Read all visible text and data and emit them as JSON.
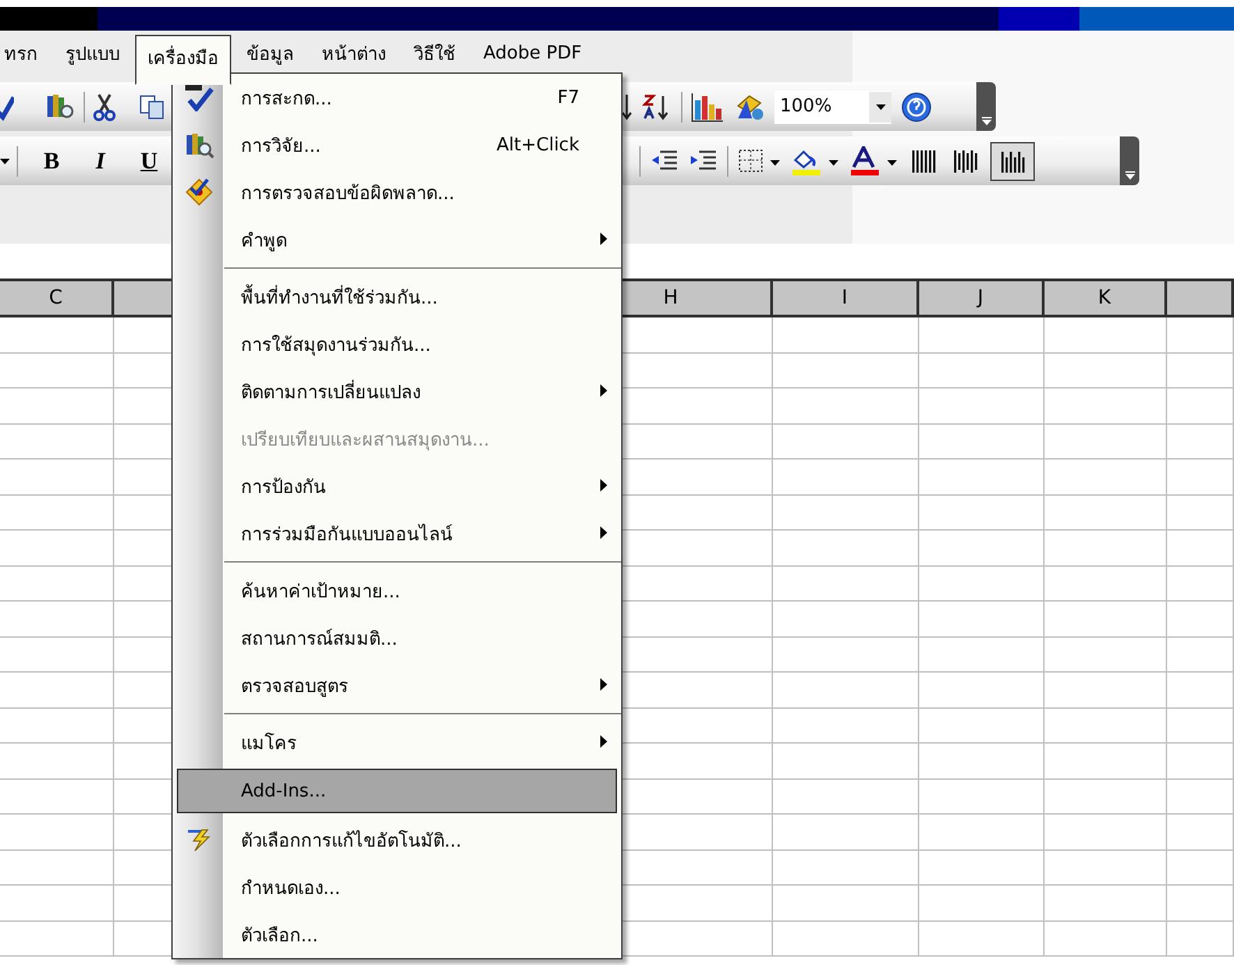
{
  "menu_bar": [
    {
      "label": "ทรก",
      "selected": false
    },
    {
      "label": "รูปแบบ",
      "selected": false
    },
    {
      "label": "เครื่องมือ",
      "selected": true
    },
    {
      "label": "ข้อมูล",
      "selected": false
    },
    {
      "label": "หน้าต่าง",
      "selected": false
    },
    {
      "label": "วิธีใช้",
      "selected": false
    },
    {
      "label": "Adobe PDF",
      "selected": false
    }
  ],
  "standard_toolbar": {
    "zoom": "100%"
  },
  "formatting_toolbar": {
    "text_buttons": [
      {
        "label": "B",
        "kind": "bold"
      },
      {
        "label": "I",
        "kind": "italic"
      },
      {
        "label": "U",
        "kind": "underline"
      }
    ],
    "layout_buttons": [
      {
        "pressed": false
      },
      {
        "pressed": false
      },
      {
        "pressed": true
      }
    ]
  },
  "menu": {
    "items": [
      {
        "kind": "item",
        "label": "การสะกด...",
        "shortcut": "F7",
        "submenu": false,
        "disabled": false,
        "selected": false
      },
      {
        "kind": "item",
        "label": "การวิจัย...",
        "shortcut": "Alt+Click",
        "submenu": false,
        "disabled": false,
        "selected": false
      },
      {
        "kind": "item",
        "label": "การตรวจสอบข้อผิดพลาด...",
        "submenu": false,
        "disabled": false,
        "selected": false
      },
      {
        "kind": "item",
        "label": "คำพูด",
        "submenu": true,
        "disabled": false,
        "selected": false
      },
      {
        "kind": "separator"
      },
      {
        "kind": "item",
        "label": "พื้นที่ทำงานที่ใช้ร่วมกัน...",
        "submenu": false,
        "disabled": false,
        "selected": false
      },
      {
        "kind": "item",
        "label": "การใช้สมุดงานร่วมกัน...",
        "submenu": false,
        "disabled": false,
        "selected": false
      },
      {
        "kind": "item",
        "label": "ติดตามการเปลี่ยนแปลง",
        "submenu": true,
        "disabled": false,
        "selected": false
      },
      {
        "kind": "item",
        "label": "เปรียบเทียบและผสานสมุดงาน...",
        "submenu": false,
        "disabled": true,
        "selected": false
      },
      {
        "kind": "item",
        "label": "การป้องกัน",
        "submenu": true,
        "disabled": false,
        "selected": false
      },
      {
        "kind": "item",
        "label": "การร่วมมือกันแบบออนไลน์",
        "submenu": true,
        "disabled": false,
        "selected": false
      },
      {
        "kind": "separator"
      },
      {
        "kind": "item",
        "label": "ค้นหาค่าเป้าหมาย...",
        "submenu": false,
        "disabled": false,
        "selected": false
      },
      {
        "kind": "item",
        "label": "สถานการณ์สมมติ...",
        "submenu": false,
        "disabled": false,
        "selected": false
      },
      {
        "kind": "item",
        "label": "ตรวจสอบสูตร",
        "submenu": true,
        "disabled": false,
        "selected": false
      },
      {
        "kind": "separator"
      },
      {
        "kind": "item",
        "label": "แมโคร",
        "submenu": true,
        "disabled": false,
        "selected": false
      },
      {
        "kind": "item",
        "label": "Add-Ins...",
        "submenu": false,
        "disabled": false,
        "selected": true
      },
      {
        "kind": "item",
        "label": "ตัวเลือกการแก้ไขอัตโนมัติ...",
        "submenu": false,
        "disabled": false,
        "selected": false
      },
      {
        "kind": "item",
        "label": "กำหนดเอง...",
        "submenu": false,
        "disabled": false,
        "selected": false
      },
      {
        "kind": "item",
        "label": "ตัวเลือก...",
        "submenu": false,
        "disabled": false,
        "selected": false
      }
    ]
  },
  "sheet": {
    "columns": [
      {
        "label": "C",
        "kind": "visible"
      },
      {
        "kind": "covered"
      },
      {
        "label": "H",
        "kind": "visible"
      },
      {
        "label": "I",
        "kind": "visible"
      },
      {
        "label": "J",
        "kind": "visible"
      },
      {
        "label": "K",
        "kind": "visible"
      },
      {
        "kind": "blank"
      }
    ]
  }
}
